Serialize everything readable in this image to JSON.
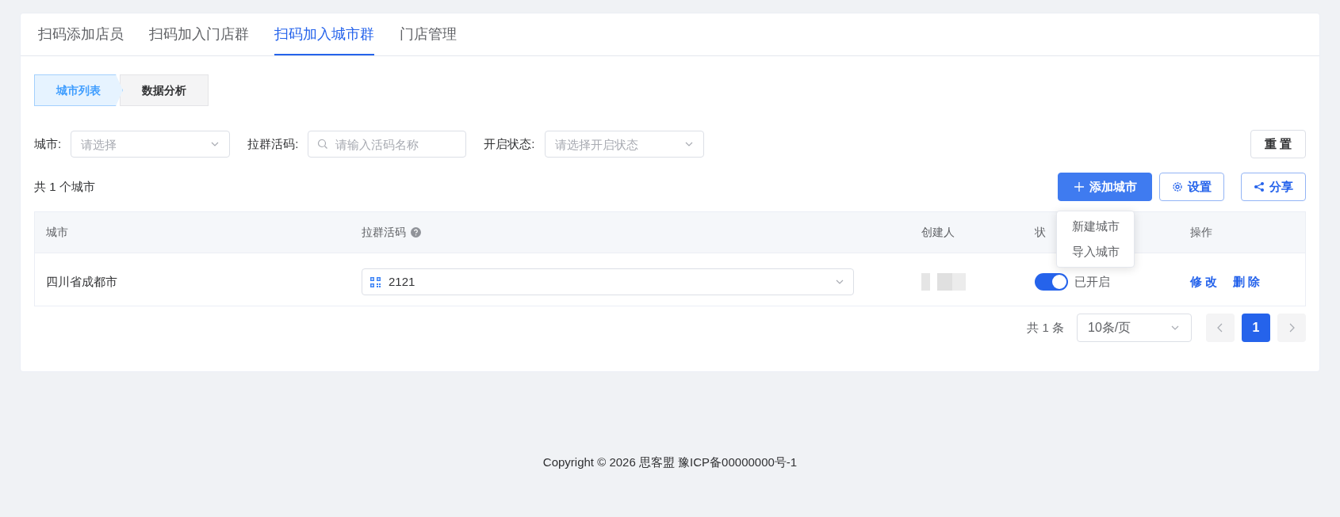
{
  "tabs": [
    {
      "label": "扫码添加店员",
      "selected": false
    },
    {
      "label": "扫码加入门店群",
      "selected": false
    },
    {
      "label": "扫码加入城市群",
      "selected": true
    },
    {
      "label": "门店管理",
      "selected": false
    }
  ],
  "steps": [
    {
      "label": "城市列表",
      "selected": true
    },
    {
      "label": "数据分析",
      "selected": false
    }
  ],
  "filters": [
    {
      "kind": "select",
      "label": "城市:",
      "placeholder": "请选择"
    },
    {
      "kind": "search",
      "label": "拉群活码:",
      "placeholder": "请输入活码名称"
    },
    {
      "kind": "select",
      "label": "开启状态:",
      "placeholder": "请选择开启状态"
    }
  ],
  "reset_button": "重 置",
  "total_text": "共 1 个城市",
  "actions": [
    {
      "kind": "primary",
      "label": "添加城市"
    },
    {
      "kind": "settings",
      "label": "设置"
    },
    {
      "kind": "share",
      "label": "分享"
    }
  ],
  "add_menu": [
    "新建城市",
    "导入城市"
  ],
  "table": {
    "columns": [
      {
        "label": "城市",
        "help": false
      },
      {
        "label": "拉群活码",
        "help": true
      },
      {
        "label": "创建人",
        "help": false
      },
      {
        "label": "状",
        "help": false
      },
      {
        "label": "操作",
        "help": false
      }
    ],
    "rows": [
      {
        "city": "四川省成都市",
        "code": "2121",
        "enabled": true,
        "status": "已开启",
        "actions": [
          "修 改",
          "删 除"
        ]
      }
    ]
  },
  "pagination": {
    "total": "共 1 条",
    "page_size": "10条/页",
    "pages": [
      {
        "label": "1",
        "selected": true
      }
    ]
  },
  "footer": "Copyright © 2026 思客盟 豫ICP备00000000号-1"
}
